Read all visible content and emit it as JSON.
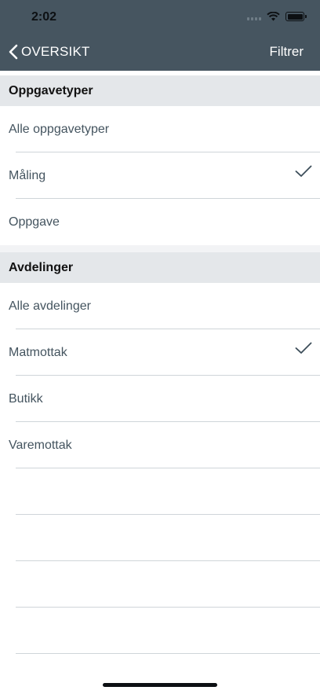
{
  "status_bar": {
    "time": "2:02"
  },
  "nav": {
    "back_label": "OVERSIKT",
    "filter_label": "Filtrer"
  },
  "sections": [
    {
      "title": "Oppgavetyper",
      "items": [
        {
          "label": "Alle oppgavetyper",
          "checked": false
        },
        {
          "label": "Måling",
          "checked": true
        },
        {
          "label": "Oppgave",
          "checked": false
        }
      ]
    },
    {
      "title": "Avdelinger",
      "items": [
        {
          "label": "Alle avdelinger",
          "checked": false
        },
        {
          "label": "Matmottak",
          "checked": true
        },
        {
          "label": "Butikk",
          "checked": false
        },
        {
          "label": "Varemottak",
          "checked": false
        }
      ]
    }
  ],
  "colors": {
    "header_bg": "#465560",
    "section_bg": "#e4e7ea",
    "accent": "#3a4a55"
  }
}
